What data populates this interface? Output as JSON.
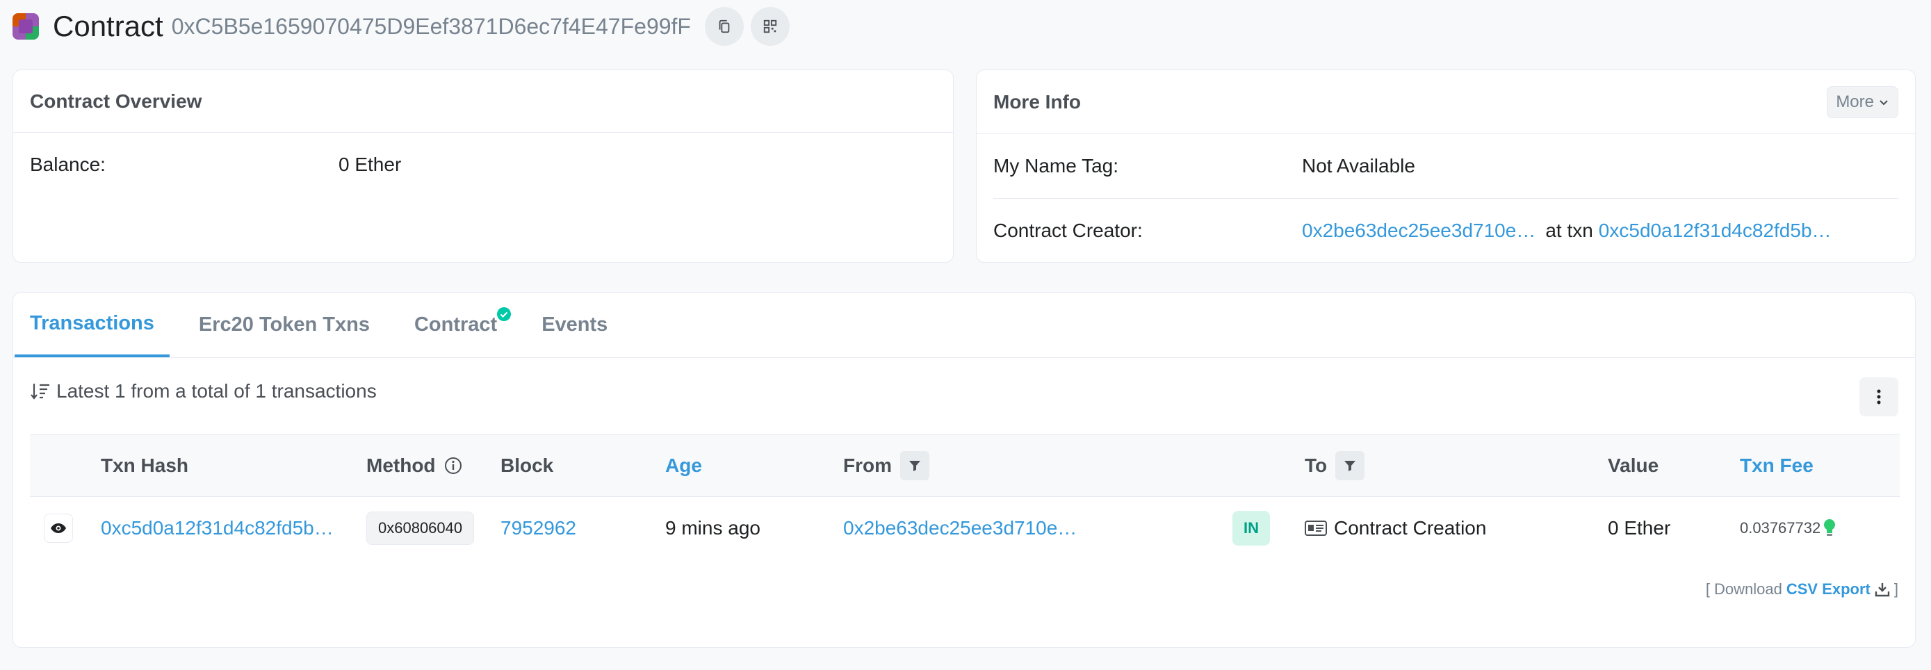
{
  "header": {
    "title": "Contract",
    "address": "0xC5B5e1659070475D9Eef3871D6ec7f4E47Fe99fF"
  },
  "overview": {
    "title": "Contract Overview",
    "balance_label": "Balance:",
    "balance_value": "0 Ether"
  },
  "more_info": {
    "title": "More Info",
    "more_button": "More",
    "name_tag_label": "My Name Tag:",
    "name_tag_value": "Not Available",
    "creator_label": "Contract Creator:",
    "creator_address": "0x2be63dec25ee3d710e…",
    "at_txn": "at txn",
    "creator_txn": "0xc5d0a12f31d4c82fd5b…"
  },
  "tabs": [
    {
      "label": "Transactions"
    },
    {
      "label": "Erc20 Token Txns"
    },
    {
      "label": "Contract"
    },
    {
      "label": "Events"
    }
  ],
  "tx_summary": "Latest 1 from a total of 1 transactions",
  "table": {
    "columns": {
      "txn_hash": "Txn Hash",
      "method": "Method",
      "block": "Block",
      "age": "Age",
      "from": "From",
      "to": "To",
      "value": "Value",
      "txn_fee": "Txn Fee"
    },
    "rows": [
      {
        "txn_hash": "0xc5d0a12f31d4c82fd5b…",
        "method": "0x60806040",
        "block": "7952962",
        "age": "9 mins ago",
        "from": "0x2be63dec25ee3d710e…",
        "direction": "IN",
        "to": "Contract Creation",
        "value": "0 Ether",
        "txn_fee": "0.03767732"
      }
    ]
  },
  "download": {
    "open": "[",
    "prefix": "Download",
    "csv_label": "CSV Export",
    "close": "]"
  },
  "colors": {
    "link": "#3498db",
    "in_badge_bg": "#d4f5ea",
    "in_badge_text": "#00a186",
    "verified": "#00c9a7"
  }
}
